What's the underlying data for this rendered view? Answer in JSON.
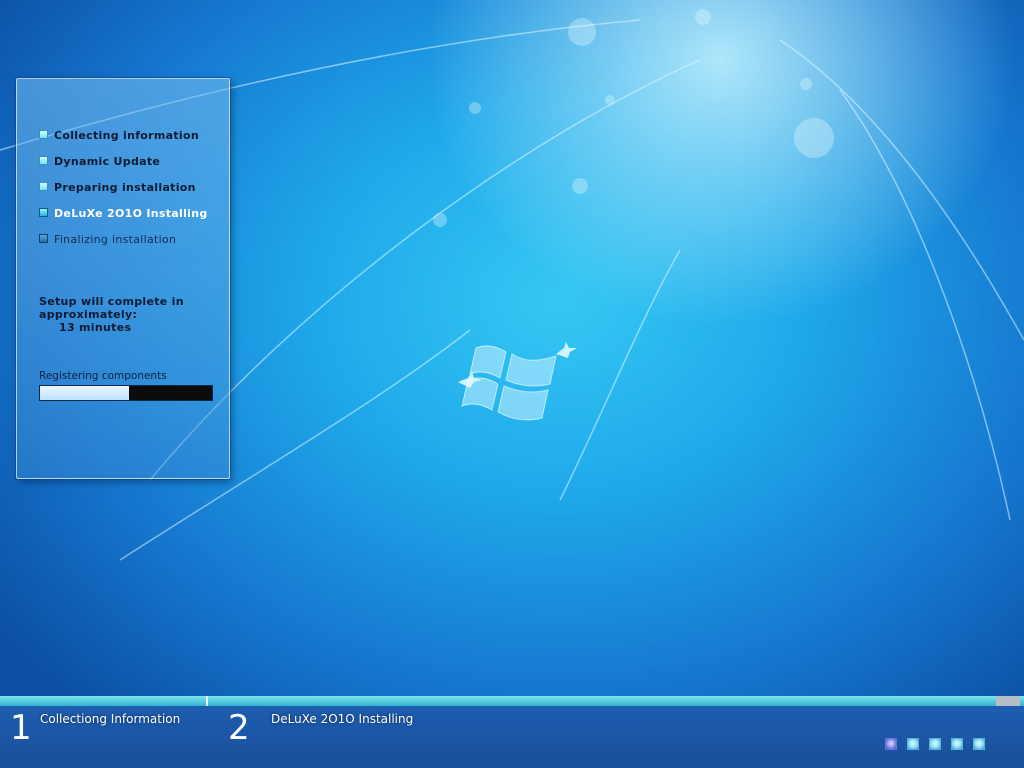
{
  "setup": {
    "steps": [
      {
        "label": "Collecting information",
        "state": "done"
      },
      {
        "label": "Dynamic Update",
        "state": "done"
      },
      {
        "label": "Preparing installation",
        "state": "done"
      },
      {
        "label": "DeLuXe 2O1O Installing",
        "state": "active"
      },
      {
        "label": "Finalizing installation",
        "state": "pending"
      }
    ],
    "time_remaining_line1": "Setup will complete in",
    "time_remaining_line2": "approximately:",
    "time_remaining_value": "13 minutes",
    "progress_label": "Registering components",
    "progress_fraction": 0.52
  },
  "bottom_bar": {
    "phases": [
      {
        "number": "1",
        "label": "Collectiong Information"
      },
      {
        "number": "2",
        "label": "DeLuXe 2O1O Installing"
      }
    ],
    "indicator_count": 5,
    "active_indicator": 0
  },
  "colors": {
    "progress_fill": "#bfe3ff",
    "progress_track": "#0c0c0c",
    "strip": "#34b4cf",
    "bar": "#1e5db0"
  },
  "icons": {
    "logo": "windows-logo-icon"
  }
}
